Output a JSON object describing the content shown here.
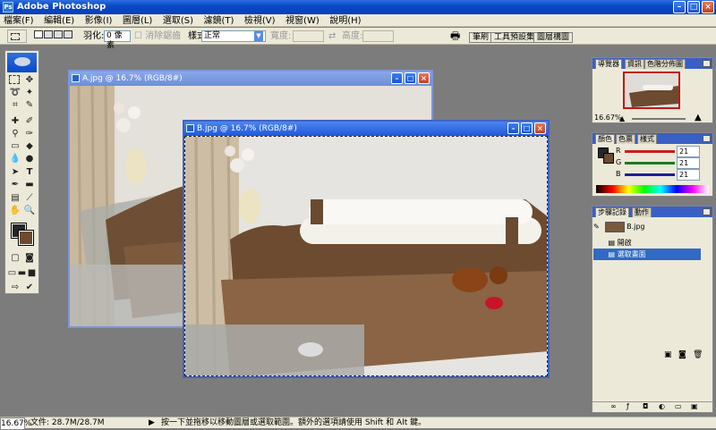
{
  "app": {
    "title": "Adobe Photoshop",
    "icon": "Ps"
  },
  "menu": [
    "檔案(F)",
    "編輯(E)",
    "影像(I)",
    "圖層(L)",
    "選取(S)",
    "濾鏡(T)",
    "檢視(V)",
    "視窗(W)",
    "說明(H)"
  ],
  "options": {
    "feather_label": "羽化:",
    "feather_value": "0 像素",
    "antialias_label": "消除鋸齒",
    "style_label": "樣式:",
    "style_value": "正常",
    "width_label": "寬度:",
    "height_label": "高度:"
  },
  "palette_well": [
    "筆刷",
    "工具預設集",
    "圖層構圖"
  ],
  "windows": {
    "a": {
      "title": "A.jpg @ 16.7% (RGB/8#)"
    },
    "b": {
      "title": "B.jpg @ 16.7% (RGB/8#)"
    }
  },
  "navigator": {
    "tabs": [
      "導覽器",
      "資訊",
      "色階分佈圖"
    ],
    "zoom": "16.67%"
  },
  "color": {
    "tabs": [
      "顏色",
      "色票",
      "樣式"
    ],
    "r_label": "R",
    "g_label": "G",
    "b_label": "B",
    "r": "21",
    "g": "21",
    "b": "21",
    "colors": {
      "r": "#c81e1e",
      "g": "#1e7a1e",
      "b": "#1e1e9a"
    }
  },
  "history": {
    "tabs": [
      "步驟記錄",
      "動作"
    ],
    "snapshot": "B.jpg",
    "items": [
      "開啟",
      "選取畫面"
    ]
  },
  "status": {
    "zoom": "16.67%",
    "doc": "文件: 28.7M/28.7M",
    "hint": "按一下並拖移以移動圖層或選取範圍。額外的選項請使用 Shift 和 Alt 鍵。"
  }
}
